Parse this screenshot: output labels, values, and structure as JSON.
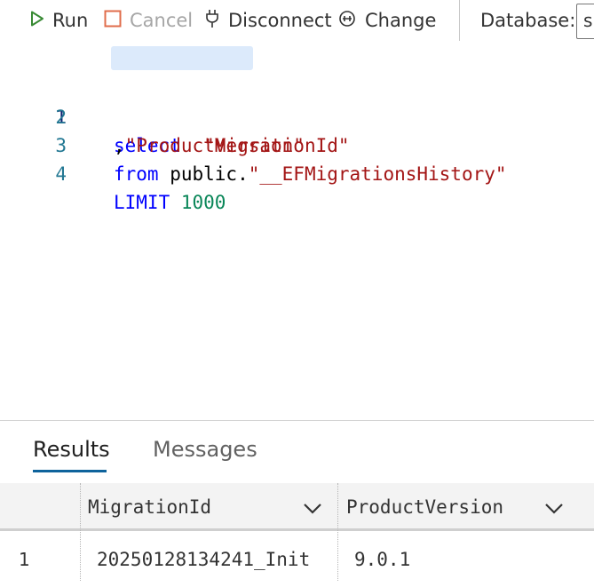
{
  "toolbar": {
    "run_label": "Run",
    "cancel_label": "Cancel",
    "disconnect_label": "Disconnect",
    "change_label": "Change",
    "database_label": "Database:",
    "database_value": "s",
    "icons": {
      "run": "play-icon",
      "cancel": "stop-icon",
      "disconnect": "plug-icon",
      "change": "change-connection-icon"
    }
  },
  "editor": {
    "lines": [
      {
        "number": "1",
        "tokens": [
          {
            "text": "select",
            "kind": "kw"
          },
          {
            "text": "  ",
            "kind": "plain"
          },
          {
            "text": "\"MigrationId\"",
            "kind": "str"
          }
        ]
      },
      {
        "number": "2",
        "tokens": [
          {
            "text": ",",
            "kind": "plain"
          },
          {
            "text": "\"ProductVersion\"",
            "kind": "str"
          }
        ]
      },
      {
        "number": "3",
        "tokens": [
          {
            "text": "from",
            "kind": "kw"
          },
          {
            "text": " public.",
            "kind": "plain"
          },
          {
            "text": "\"__EFMigrationsHistory\"",
            "kind": "str"
          }
        ]
      },
      {
        "number": "4",
        "tokens": [
          {
            "text": "LIMIT",
            "kind": "kw"
          },
          {
            "text": " ",
            "kind": "plain"
          },
          {
            "text": "1000",
            "kind": "num"
          }
        ]
      }
    ]
  },
  "results": {
    "tabs": [
      {
        "label": "Results",
        "active": true
      },
      {
        "label": "Messages",
        "active": false
      }
    ],
    "columns": [
      "MigrationId",
      "ProductVersion"
    ],
    "rows": [
      {
        "index": "1",
        "cells": [
          "20250128134241_Init",
          "9.0.1"
        ]
      }
    ]
  },
  "colors": {
    "keyword": "#0000ff",
    "string": "#a31515",
    "number": "#098658",
    "line_number": "#237893",
    "run_icon": "#388a34",
    "cancel_icon": "#e06c4b",
    "tab_underline": "#0e639c"
  }
}
